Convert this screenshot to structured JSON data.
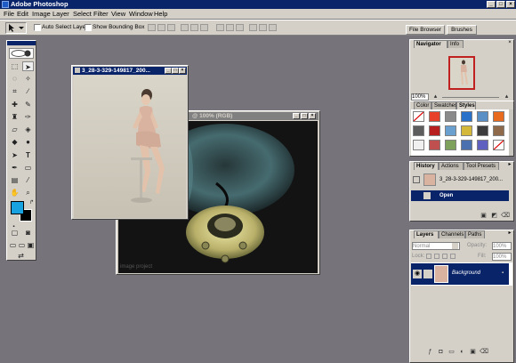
{
  "app": {
    "title": "Adobe Photoshop"
  },
  "window_controls": {
    "minimize": "_",
    "maximize": "□",
    "close": "×"
  },
  "menu": [
    "File",
    "Edit",
    "Image",
    "Layer",
    "Select",
    "Filter",
    "View",
    "Window",
    "Help"
  ],
  "options": {
    "auto_select_layer": "Auto Select Layer",
    "show_bounding_box": "Show Bounding Box"
  },
  "palette_well": {
    "tabs": [
      "File Browser",
      "Brushes"
    ]
  },
  "toolbox": {
    "foreground_color": "#19a2e0",
    "background_color": "#000000"
  },
  "documents": [
    {
      "title": "3_28-3-329-149817_200...",
      "active": true
    },
    {
      "title": "t1 @ 100% (RGB)",
      "visible_title": "@ 100% (RGB)",
      "active": false,
      "watermark": "image project"
    }
  ],
  "navigator": {
    "tabs": [
      "Navigator",
      "Info"
    ],
    "zoom": "100%"
  },
  "styles": {
    "tabs": [
      "Color",
      "Swatches",
      "Styles"
    ],
    "colors": [
      "#ffffff",
      "#e8412a",
      "#8a8a8a",
      "#2a72c9",
      "#5a8fc6",
      "#e86a1e",
      "#5d5d5d",
      "#b82020",
      "#6aa0d0",
      "#d4b83a",
      "#3c3c3c",
      "#8f6a4a",
      "#f0f0f0",
      "#c05050",
      "#7da15a",
      "#c04040",
      "#9a9a9a",
      "#c8c8c8",
      "#4a70b0",
      "#6060c0",
      "#a0a0a0",
      "#c03030",
      "#c8d0e0",
      "#ffffff"
    ]
  },
  "history": {
    "tabs": [
      "History",
      "Actions",
      "Tool Presets"
    ],
    "snapshot": "3_28-3-329-149817_200...",
    "states": [
      "Open"
    ]
  },
  "layers": {
    "tabs": [
      "Layers",
      "Channels",
      "Paths"
    ],
    "blend_mode": "Normal",
    "opacity_label": "Opacity:",
    "opacity": "100%",
    "lock_label": "Lock:",
    "fill_label": "Fill:",
    "fill": "100%",
    "items": [
      {
        "name": "Background"
      }
    ]
  }
}
